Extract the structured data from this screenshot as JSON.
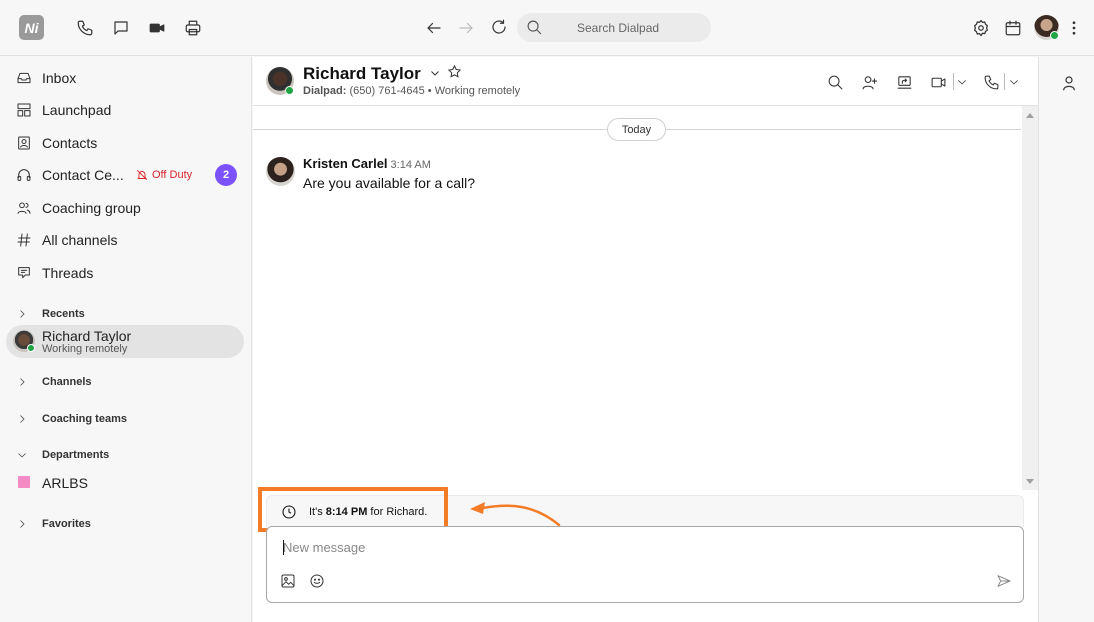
{
  "topbar": {
    "logo_text": "Ni",
    "search_placeholder": "Search Dialpad",
    "icons": [
      "phone-icon",
      "message-icon",
      "video-icon",
      "print-icon",
      "back-arrow-icon",
      "forward-arrow-icon",
      "refresh-icon",
      "search-icon",
      "gear-icon",
      "calendar-icon",
      "more-vertical-icon"
    ]
  },
  "sidebar": {
    "items": [
      {
        "label": "Inbox",
        "icon": "inbox-icon"
      },
      {
        "label": "Launchpad",
        "icon": "launchpad-icon"
      },
      {
        "label": "Contacts",
        "icon": "contacts-icon"
      },
      {
        "label": "Contact Ce...",
        "icon": "headset-icon",
        "status": "Off Duty",
        "badge": "2"
      },
      {
        "label": "Coaching group",
        "icon": "users-icon"
      },
      {
        "label": "All channels",
        "icon": "hash-icon"
      },
      {
        "label": "Threads",
        "icon": "threads-icon"
      }
    ],
    "sections": {
      "recents": "Recents",
      "channels": "Channels",
      "coaching_teams": "Coaching teams",
      "departments": "Departments",
      "favorites": "Favorites"
    },
    "recent_contact": {
      "name": "Richard Taylor",
      "status": "Working remotely"
    },
    "departments": [
      {
        "label": "ARLBS",
        "color": "#f58bc4"
      }
    ]
  },
  "conversation": {
    "name": "Richard Taylor",
    "sub_label": "Dialpad:",
    "phone": "(650) 761-4645",
    "separator": "•",
    "status": "Working remotely",
    "date_divider": "Today",
    "messages": [
      {
        "author": "Kristen Carlel",
        "time": "3:14 AM",
        "text": "Are you available for a call?"
      }
    ],
    "timezone_notice": {
      "prefix": "It's",
      "time": "8:14 PM",
      "suffix": "for Richard."
    },
    "composer_placeholder": "New message"
  },
  "colors": {
    "accent": "#7c52ff",
    "off_duty": "#d9232d",
    "presence": "#1fa344",
    "highlight": "#f47c26"
  }
}
